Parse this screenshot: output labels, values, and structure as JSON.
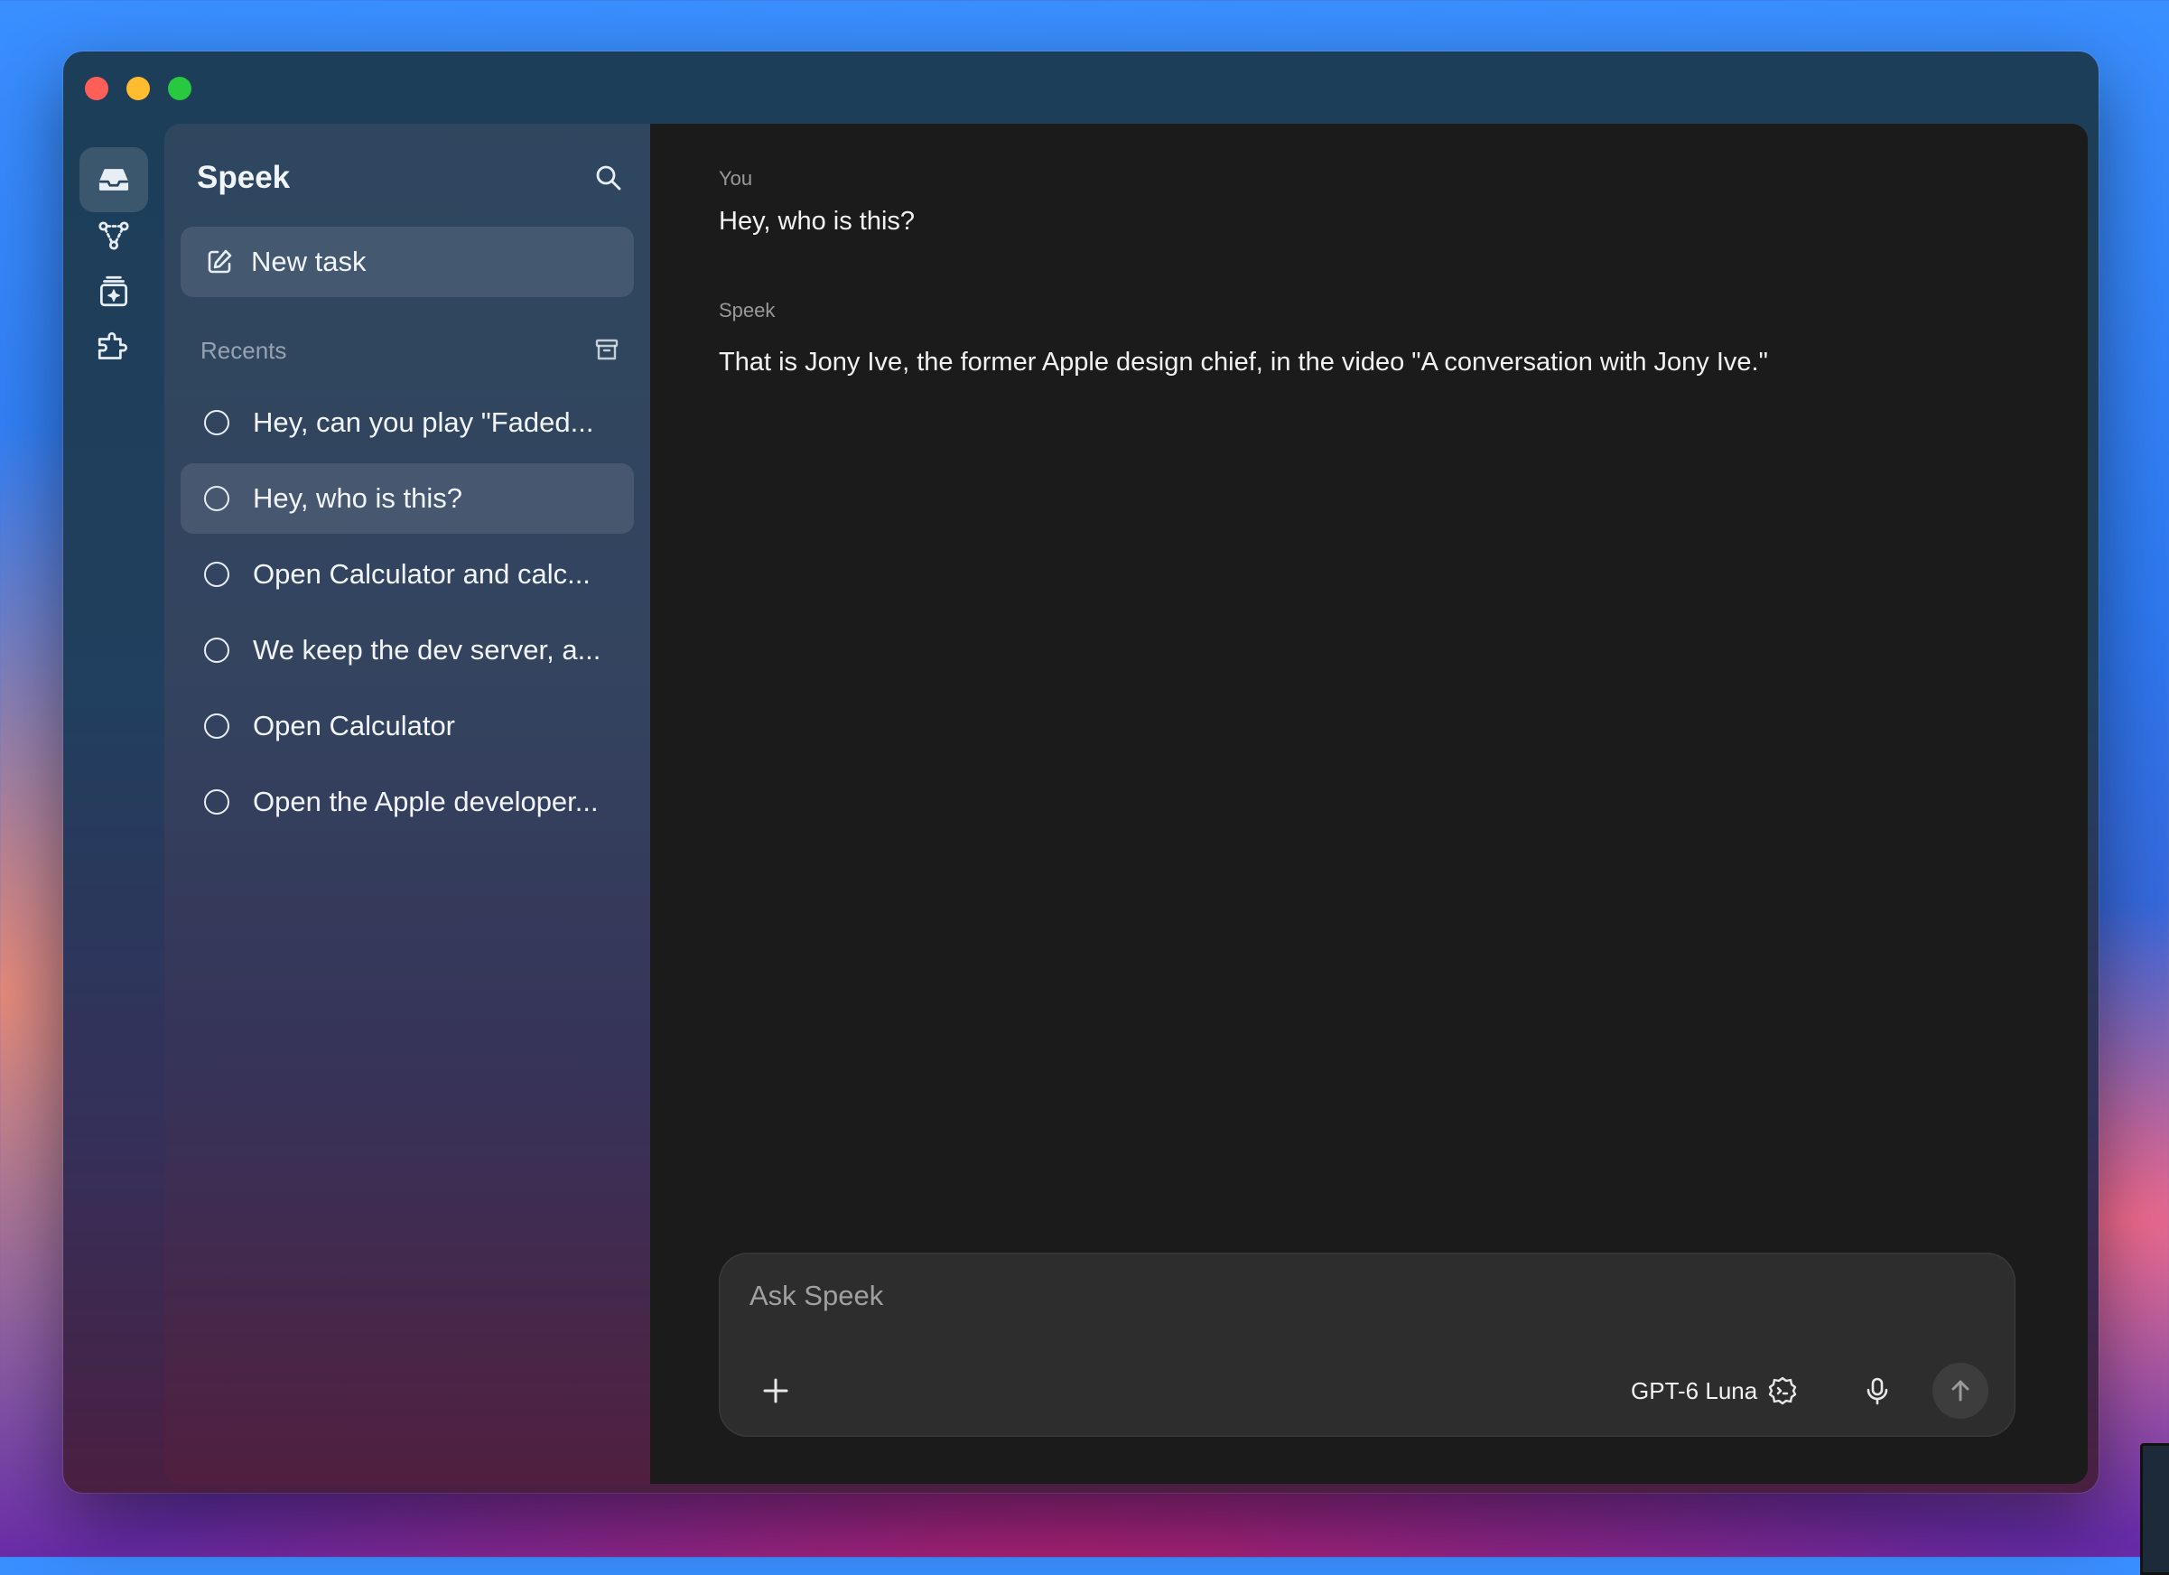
{
  "app": {
    "title": "Speek"
  },
  "sidebar": {
    "new_task_label": "New task",
    "recents_label": "Recents",
    "recents": [
      {
        "title": "Hey, can you play \"Faded...",
        "selected": false
      },
      {
        "title": "Hey, who is this?",
        "selected": true
      },
      {
        "title": "Open Calculator and calc...",
        "selected": false
      },
      {
        "title": "We keep the dev server, a...",
        "selected": false
      },
      {
        "title": "Open Calculator",
        "selected": false
      },
      {
        "title": "Open the Apple developer...",
        "selected": false
      }
    ]
  },
  "rail": {
    "icons": [
      "inbox-icon",
      "workflow-icon",
      "stack-sparkle-icon",
      "plugin-icon",
      "gear-icon"
    ]
  },
  "conversation": {
    "messages": [
      {
        "speaker": "You",
        "text": "Hey, who is this?"
      },
      {
        "speaker": "Speek",
        "text": "That is Jony Ive, the former Apple design chief, in the video \"A conversation with Jony Ive.\""
      }
    ]
  },
  "composer": {
    "placeholder": "Ask Speek",
    "value": "",
    "model_name": "GPT-6 Luna"
  },
  "colors": {
    "traffic_red": "#ff5f57",
    "traffic_yellow": "#febc2e",
    "traffic_green": "#28c840",
    "main_background": "#1b1b1b",
    "composer_background": "#2d2d2d"
  }
}
